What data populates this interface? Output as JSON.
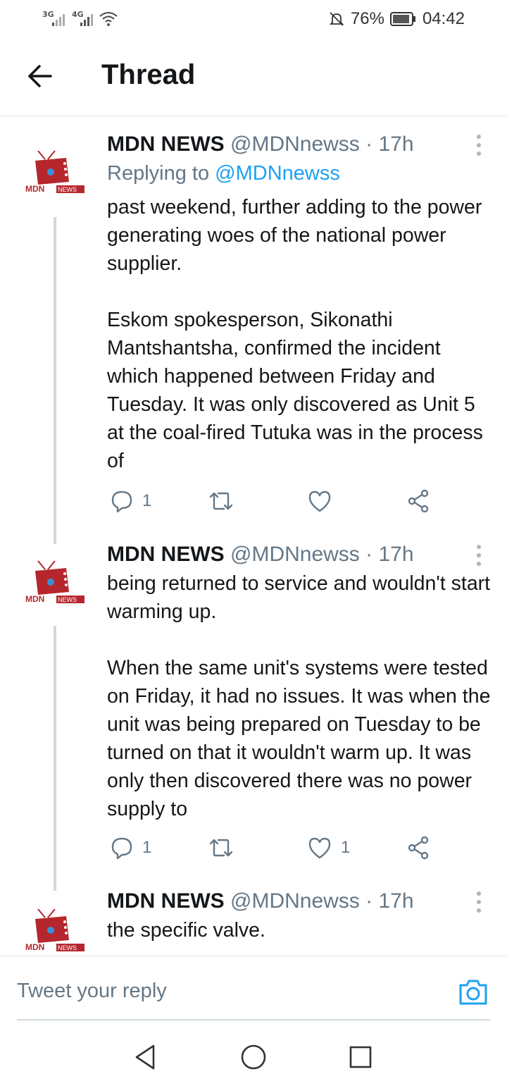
{
  "status_bar": {
    "network1": "3G",
    "network2": "4G",
    "battery": "76%",
    "time": "04:42"
  },
  "header": {
    "title": "Thread"
  },
  "tweets": [
    {
      "name": "MDN NEWS",
      "handle": "@MDNnewss",
      "sep": "·",
      "time": "17h",
      "replying_prefix": "Replying to",
      "replying_handle": "@MDNnewss",
      "text": "past weekend, further adding to the power generating woes of the national power supplier.\n\nEskom spokesperson, Sikonathi Mantshantsha, confirmed the incident which happened between Friday and Tuesday. It was only discovered as Unit 5 at the coal-fired Tutuka was in the process of",
      "replies": "1",
      "retweets": "",
      "likes": ""
    },
    {
      "name": "MDN NEWS",
      "handle": "@MDNnewss",
      "sep": "·",
      "time": "17h",
      "text": "being returned to service and wouldn't start warming up.\n\nWhen the same unit's systems were tested on Friday, it had no issues. It was when the unit was being prepared on Tuesday to be turned on that it wouldn't warm up. It was only then discovered there was no power supply to",
      "replies": "1",
      "retweets": "",
      "likes": "1"
    },
    {
      "name": "MDN NEWS",
      "handle": "@MDNnewss",
      "sep": "·",
      "time": "17h",
      "text": "the specific valve."
    }
  ],
  "avatar": {
    "brand": "MDN",
    "badge": "NEWS",
    "color": "#b5272d"
  },
  "reply_bar": {
    "placeholder": "Tweet your reply"
  },
  "icons": [
    "back-arrow-icon",
    "more-icon",
    "reply-icon",
    "retweet-icon",
    "like-icon",
    "share-icon",
    "camera-icon",
    "nav-back-icon",
    "nav-home-icon",
    "nav-recents-icon"
  ],
  "colors": {
    "accent": "#1da1f2",
    "muted": "#657786"
  }
}
